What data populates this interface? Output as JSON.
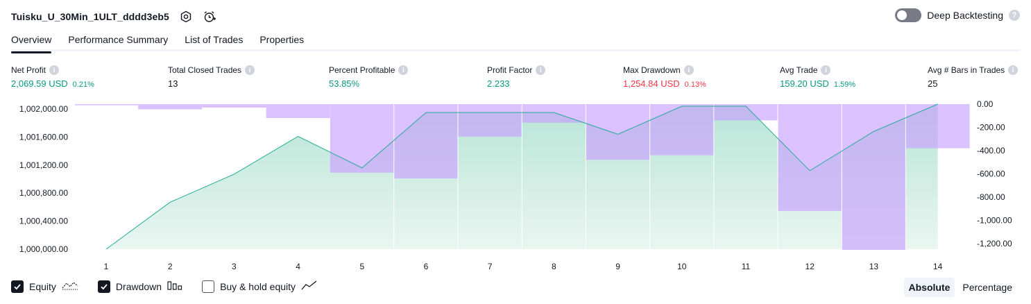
{
  "header": {
    "strategy_name": "Tuisku_U_30Min_1ULT_dddd3eb5",
    "settings_icon": "settings-gear-icon",
    "alert_icon": "add-alert-clock-icon"
  },
  "deep_backtesting": {
    "label": "Deep Backtesting",
    "enabled": false,
    "help": "?"
  },
  "tabs": [
    {
      "label": "Overview",
      "active": true
    },
    {
      "label": "Performance Summary",
      "active": false
    },
    {
      "label": "List of Trades",
      "active": false
    },
    {
      "label": "Properties",
      "active": false
    }
  ],
  "metrics": {
    "net_profit": {
      "label": "Net Profit",
      "value": "2,069.59 USD",
      "sub": "0.21%",
      "info": "i"
    },
    "total_closed_trades": {
      "label": "Total Closed Trades",
      "value": "13",
      "info": "i"
    },
    "percent_profitable": {
      "label": "Percent Profitable",
      "value": "53.85%",
      "info": "i"
    },
    "profit_factor": {
      "label": "Profit Factor",
      "value": "2.233",
      "info": "i"
    },
    "max_drawdown": {
      "label": "Max Drawdown",
      "value": "1,254.84 USD",
      "sub": "0.13%",
      "info": "i"
    },
    "avg_trade": {
      "label": "Avg Trade",
      "value": "159.20 USD",
      "sub": "1.59%",
      "info": "i"
    },
    "avg_bars": {
      "label": "Avg # Bars in Trades",
      "value": "25",
      "info": "i"
    }
  },
  "colors": {
    "equity_line": "#22ab94",
    "drawdown_fill": "#c9a0ff",
    "positive": "#089981",
    "negative": "#f23645"
  },
  "chart_data": {
    "type": "line",
    "x": [
      1,
      2,
      3,
      4,
      5,
      6,
      7,
      8,
      9,
      10,
      11,
      12,
      13,
      14
    ],
    "left_axis": {
      "ticks": [
        "1,002,000.00",
        "1,001,600.00",
        "1,001,200.00",
        "1,000,800.00",
        "1,000,400.00",
        "1,000,000.00"
      ],
      "ylim": [
        1000000,
        1002070
      ]
    },
    "right_axis": {
      "ticks": [
        "0.00",
        "-200.00",
        "-400.00",
        "-600.00",
        "-800.00",
        "-1,000.00",
        "-1,200.00"
      ],
      "ylim": [
        -1254.84,
        0
      ]
    },
    "series": [
      {
        "name": "Equity",
        "axis": "left",
        "values": [
          1000000,
          1000670,
          1001070,
          1001610,
          1001160,
          1001950,
          1001950,
          1001950,
          1001640,
          1002040,
          1002040,
          1001120,
          1001680,
          1002070
        ]
      },
      {
        "name": "Drawdown",
        "axis": "right",
        "values": [
          -10,
          -45,
          -30,
          -120,
          -590,
          -640,
          -280,
          -160,
          -480,
          -440,
          -140,
          -920,
          -1254.84,
          -380
        ]
      }
    ]
  },
  "legend": [
    {
      "label": "Equity",
      "checked": true,
      "icon": "equity-line-icon"
    },
    {
      "label": "Drawdown",
      "checked": true,
      "icon": "drawdown-bars-icon"
    },
    {
      "label": "Buy & hold equity",
      "checked": false,
      "icon": "buy-hold-line-icon"
    }
  ],
  "mode_buttons": [
    {
      "label": "Absolute",
      "active": true
    },
    {
      "label": "Percentage",
      "active": false
    }
  ]
}
